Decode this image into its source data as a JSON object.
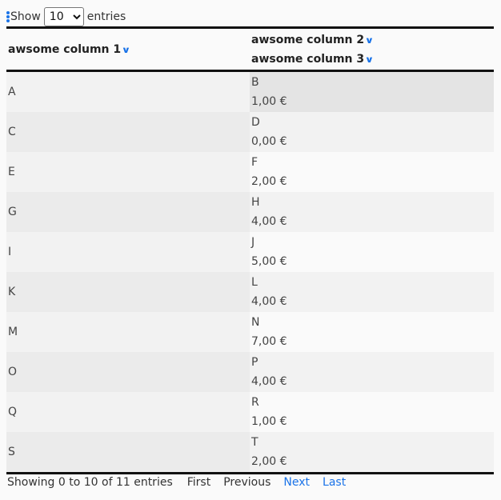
{
  "length_menu": {
    "show_label": "Show",
    "selected": "10",
    "entries_label": "entries"
  },
  "columns": [
    {
      "label": "awsome column 1",
      "icon": "chevron-down-icon"
    },
    {
      "label": "awsome column 2",
      "icon": "chevron-down-icon"
    },
    {
      "label": "awsome column 3",
      "icon": "chevron-down-icon"
    }
  ],
  "rows": [
    {
      "col1": "A",
      "col2": "B",
      "col3": "1,00 €"
    },
    {
      "col1": "C",
      "col2": "D",
      "col3": "0,00 €"
    },
    {
      "col1": "E",
      "col2": "F",
      "col3": "2,00 €"
    },
    {
      "col1": "G",
      "col2": "H",
      "col3": "4,00 €"
    },
    {
      "col1": "I",
      "col2": "J",
      "col3": "5,00 €"
    },
    {
      "col1": "K",
      "col2": "L",
      "col3": "4,00 €"
    },
    {
      "col1": "M",
      "col2": "N",
      "col3": "7,00 €"
    },
    {
      "col1": "O",
      "col2": "P",
      "col3": "4,00 €"
    },
    {
      "col1": "Q",
      "col2": "R",
      "col3": "1,00 €"
    },
    {
      "col1": "S",
      "col2": "T",
      "col3": "2,00 €"
    }
  ],
  "footer": {
    "info": "Showing 0 to 10 of 11 entries",
    "first": "First",
    "previous": "Previous",
    "next": "Next",
    "last": "Last"
  },
  "colors": {
    "accent": "#1a73e8",
    "border": "#111111"
  }
}
